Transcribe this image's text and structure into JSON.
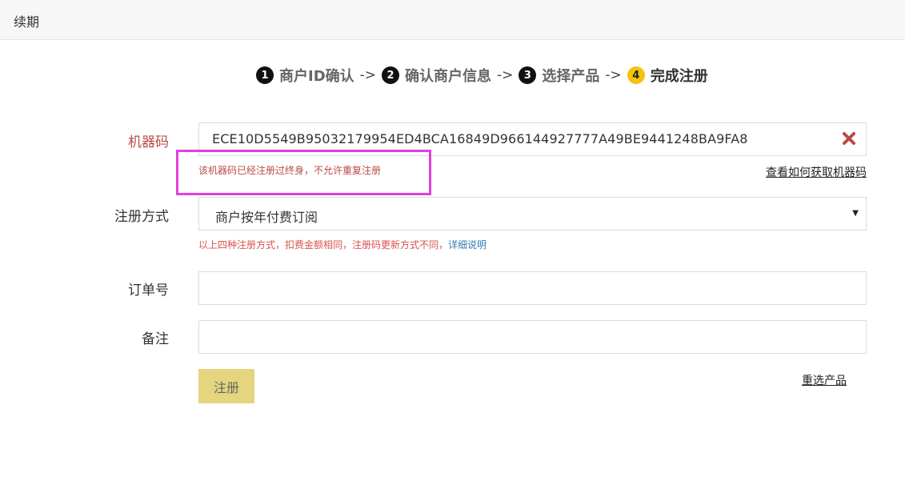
{
  "header": {
    "title": "续期"
  },
  "steps": [
    {
      "num": "1",
      "label": "商户ID确认"
    },
    {
      "num": "2",
      "label": "确认商户信息"
    },
    {
      "num": "3",
      "label": "选择产品"
    },
    {
      "num": "4",
      "label": "完成注册"
    }
  ],
  "step_separator": "->",
  "form": {
    "machine_code": {
      "label": "机器码",
      "value": "ECE10D5549B95032179954ED4BCA16849D966144927777A49BE9441248BA9FA8",
      "error": "该机器码已经注册过终身，不允许重复注册",
      "howto_link": "查看如何获取机器码",
      "clear_icon": "close-x-icon",
      "error_color": "#b94a48"
    },
    "reg_method": {
      "label": "注册方式",
      "selected": "商户按年付费订阅",
      "note": "以上四种注册方式，扣费金额相同，注册码更新方式不同，",
      "note_link": "详细说明"
    },
    "order_no": {
      "label": "订单号",
      "value": ""
    },
    "remark": {
      "label": "备注",
      "value": ""
    },
    "submit_label": "注册",
    "reselect_link": "重选产品"
  },
  "colors": {
    "active_step": "#f4c20d",
    "submit_button": "#e5d57f",
    "highlight_box": "#e040e0",
    "link": "#337ab7"
  }
}
